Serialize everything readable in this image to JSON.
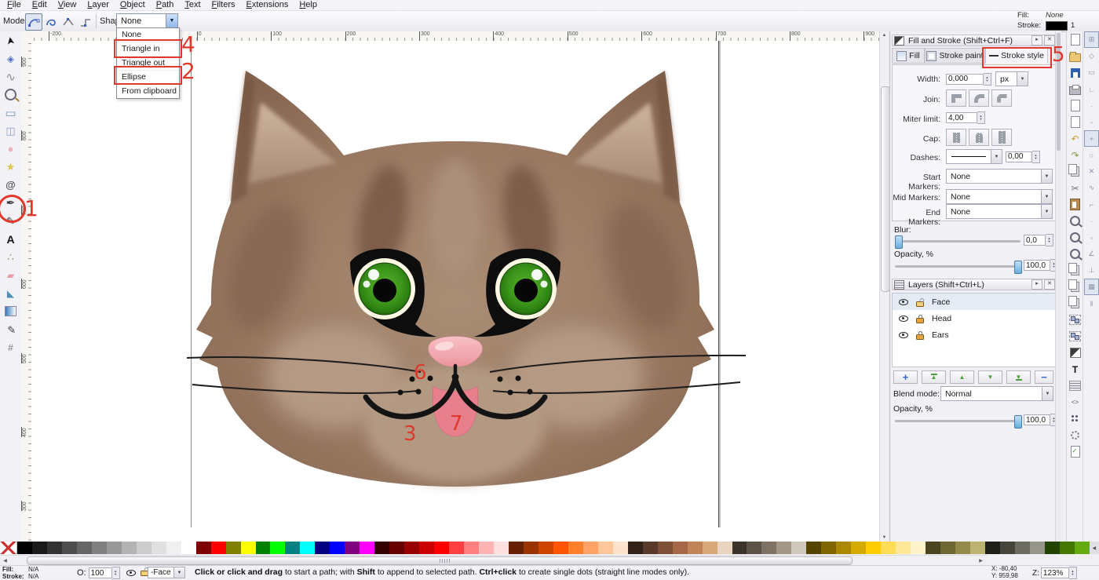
{
  "menu": {
    "items": [
      "File",
      "Edit",
      "View",
      "Layer",
      "Object",
      "Path",
      "Text",
      "Filters",
      "Extensions",
      "Help"
    ]
  },
  "toolbar": {
    "mode_label": "Mode:",
    "shape_label": "Shape:",
    "shape_value": "None"
  },
  "swatch_indicator": {
    "fill_label": "Fill:",
    "fill_value": "None",
    "stroke_label": "Stroke:",
    "stroke_width": "1",
    "stroke_color": "#000000"
  },
  "shape_menu": {
    "items": [
      "None",
      "Triangle in",
      "Triangle out",
      "Ellipse",
      "From clipboard"
    ]
  },
  "annotations": {
    "color": "#e0382b",
    "labels": {
      "tool": "1",
      "ellipse": "2",
      "mouth": "3",
      "triangle_in": "4",
      "stroke_style": "5",
      "dots": "6",
      "tongue": "7"
    }
  },
  "rulers": {
    "top": [
      "-200",
      "-100",
      "0",
      "100",
      "200",
      "300",
      "400",
      "500",
      "600",
      "700",
      "800",
      "900"
    ],
    "left": [
      "900",
      "800",
      "700",
      "600",
      "500",
      "400",
      "300"
    ]
  },
  "toolbox": {
    "tools": [
      "selector",
      "node-editor",
      "tweak",
      "zoom",
      "rectangle",
      "box-3d",
      "ellipse",
      "star",
      "spiral",
      "bezier-pen",
      "calligraphy",
      "text",
      "spray",
      "eraser",
      "paint-bucket",
      "gradient",
      "dropper",
      "connector"
    ]
  },
  "commands": [
    "new-document",
    "open",
    "save",
    "print",
    "import",
    "export",
    "undo",
    "redo",
    "copy",
    "cut",
    "paste",
    "zoom-selection",
    "zoom-drawing",
    "zoom-page",
    "duplicate",
    "create-clone",
    "unlink-clone",
    "group",
    "ungroup",
    "fill-stroke-dialog",
    "text-dialog",
    "layers-dialog",
    "xml-editor",
    "align-dialog",
    "preferences",
    "document-properties"
  ],
  "snap": [
    "snap-enable",
    "snap-bounding-box",
    "snap-bbox-edges",
    "snap-bbox-corners",
    "snap-bbox-midpoints",
    "snap-bbox-centers",
    "snap-nodes",
    "snap-paths",
    "snap-path-intersections",
    "snap-cusp-nodes",
    "snap-smooth-nodes",
    "snap-midpoints",
    "snap-object-centers",
    "snap-rotation-centers",
    "snap-page-border",
    "snap-grid",
    "snap-guides"
  ],
  "fill_stroke": {
    "title": "Fill and Stroke (Shift+Ctrl+F)",
    "tabs": [
      {
        "label": "Fill"
      },
      {
        "label": "Stroke paint"
      },
      {
        "label": "Stroke style"
      }
    ],
    "width_label": "Width:",
    "width_value": "0,000",
    "unit": "px",
    "join_label": "Join:",
    "miter_label": "Miter limit:",
    "miter_value": "4,00",
    "cap_label": "Cap:",
    "dashes_label": "Dashes:",
    "dashes_offset": "0,00",
    "start_label": "Start Markers:",
    "start_value": "None",
    "mid_label": "Mid Markers:",
    "mid_value": "None",
    "end_label": "End Markers:",
    "end_value": "None",
    "blur_label": "Blur:",
    "blur_value": "0,0",
    "opacity_label": "Opacity, %",
    "opacity_value": "100,0"
  },
  "layers_panel": {
    "title": "Layers (Shift+Ctrl+L)",
    "items": [
      {
        "name": "Face",
        "locked": false,
        "visible": true,
        "selected": true
      },
      {
        "name": "Head",
        "locked": true,
        "visible": true,
        "selected": false
      },
      {
        "name": "Ears",
        "locked": true,
        "visible": true,
        "selected": false
      }
    ],
    "blend_label": "Blend mode:",
    "blend_value": "Normal",
    "opacity_label": "Opacity, %",
    "opacity_value": "100,0"
  },
  "statusbar": {
    "fill_label": "Fill:",
    "fill_value": "N/A",
    "stroke_label": "Stroke:",
    "stroke_value": "N/A",
    "opacity_abbr": "O:",
    "opacity_value": "100",
    "layer_value": "-Face",
    "message": [
      {
        "text": "Click or click and drag",
        "bold": true
      },
      {
        "text": " to start a path; with ",
        "bold": false
      },
      {
        "text": "Shift",
        "bold": true
      },
      {
        "text": " to append to selected path. ",
        "bold": false
      },
      {
        "text": "Ctrl+click",
        "bold": true
      },
      {
        "text": " to create single dots (straight line modes only).",
        "bold": false
      }
    ],
    "x_label": "X:",
    "x_value": "-80,40",
    "y_label": "Y:",
    "y_value": "959,98",
    "z_label": "Z:",
    "z_value": "123%"
  },
  "palette": {
    "colors": [
      "#000000",
      "#1a1a1a",
      "#333333",
      "#4d4d4d",
      "#666666",
      "#808080",
      "#999999",
      "#b3b3b3",
      "#cccccc",
      "#e0e0e0",
      "#f0f0f0",
      "#ffffff",
      "#800000",
      "#ff0000",
      "#808000",
      "#ffff00",
      "#008000",
      "#00ff00",
      "#008080",
      "#00ffff",
      "#000080",
      "#0000ff",
      "#800080",
      "#ff00ff",
      "#330000",
      "#660000",
      "#990000",
      "#cc0000",
      "#ff0000",
      "#ff4040",
      "#ff8080",
      "#ffb3b3",
      "#ffe0e0",
      "#662200",
      "#993300",
      "#cc4400",
      "#ff5500",
      "#ff7f2a",
      "#ffa366",
      "#ffc699",
      "#ffe2cc",
      "#33221a",
      "#59392a",
      "#7f5038",
      "#a56747",
      "#c08456",
      "#d8a878",
      "#e9d4c0",
      "#3a332c",
      "#5c5348",
      "#7e7265",
      "#a29687",
      "#cfc8bd",
      "#554400",
      "#806600",
      "#aa8800",
      "#d4aa00",
      "#ffcc00",
      "#ffdd55",
      "#ffe899",
      "#fff4cc",
      "#4a4520",
      "#6e6733",
      "#938a4a",
      "#bcb372",
      "#20201a",
      "#45453c",
      "#6b6b60",
      "#95958a",
      "#224400",
      "#447700",
      "#66aa11"
    ]
  },
  "cat": {
    "colors": {
      "head": "#9a7962",
      "head_dark": "#6f503d",
      "head_light": "#b79d87",
      "ear_inner": "#c7ae97",
      "iris_green": "#3c961b",
      "nose_pink": "#f2a3a9",
      "tongue_pink": "#e77f8d",
      "line": "#141414"
    }
  }
}
